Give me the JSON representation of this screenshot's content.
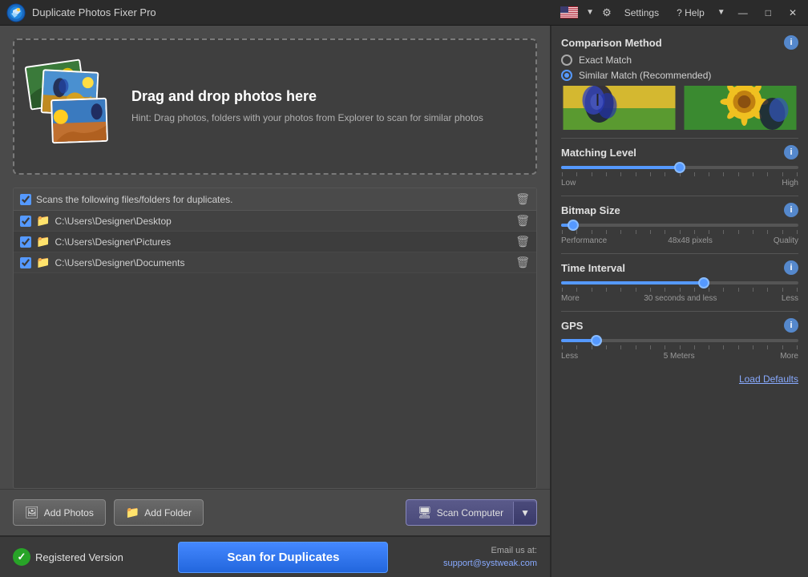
{
  "titleBar": {
    "appTitle": "Duplicate Photos Fixer Pro",
    "settingsLabel": "Settings",
    "helpLabel": "? Help",
    "menuItems": [
      "Settings",
      "? Help"
    ]
  },
  "dropZone": {
    "heading": "Drag and drop photos here",
    "hint": "Hint: Drag photos, folders with your photos from Explorer to scan for similar photos"
  },
  "fileList": {
    "headerText": "Scans the following files/folders for duplicates.",
    "items": [
      {
        "path": "C:\\Users\\Designer\\Desktop",
        "checked": true
      },
      {
        "path": "C:\\Users\\Designer\\Pictures",
        "checked": true
      },
      {
        "path": "C:\\Users\\Designer\\Documents",
        "checked": true
      }
    ]
  },
  "actionBar": {
    "addPhotosLabel": "Add Photos",
    "addFolderLabel": "Add Folder",
    "scanComputerLabel": "Scan Computer"
  },
  "bottomBar": {
    "registeredLabel": "Registered Version",
    "scanButtonLabel": "Scan for Duplicates",
    "emailLabel": "Email us at:",
    "emailAddress": "support@systweak.com"
  },
  "rightPanel": {
    "comparisonMethod": {
      "title": "Comparison Method",
      "options": [
        {
          "label": "Exact Match",
          "selected": false
        },
        {
          "label": "Similar Match (Recommended)",
          "selected": true
        }
      ]
    },
    "matchingLevel": {
      "title": "Matching Level",
      "lowLabel": "Low",
      "highLabel": "High",
      "thumbPosition": 50
    },
    "bitmapSize": {
      "title": "Bitmap Size",
      "performanceLabel": "Performance",
      "qualityLabel": "Quality",
      "sizeLabel": "48x48 pixels",
      "thumbPosition": 5
    },
    "timeInterval": {
      "title": "Time Interval",
      "moreLabel": "More",
      "lessLabel": "Less",
      "valueLabel": "30 seconds and less",
      "thumbPosition": 60
    },
    "gps": {
      "title": "GPS",
      "lessLabel": "Less",
      "moreLabel": "More",
      "valueLabel": "5 Meters",
      "thumbPosition": 15
    },
    "loadDefaultsLabel": "Load Defaults"
  }
}
